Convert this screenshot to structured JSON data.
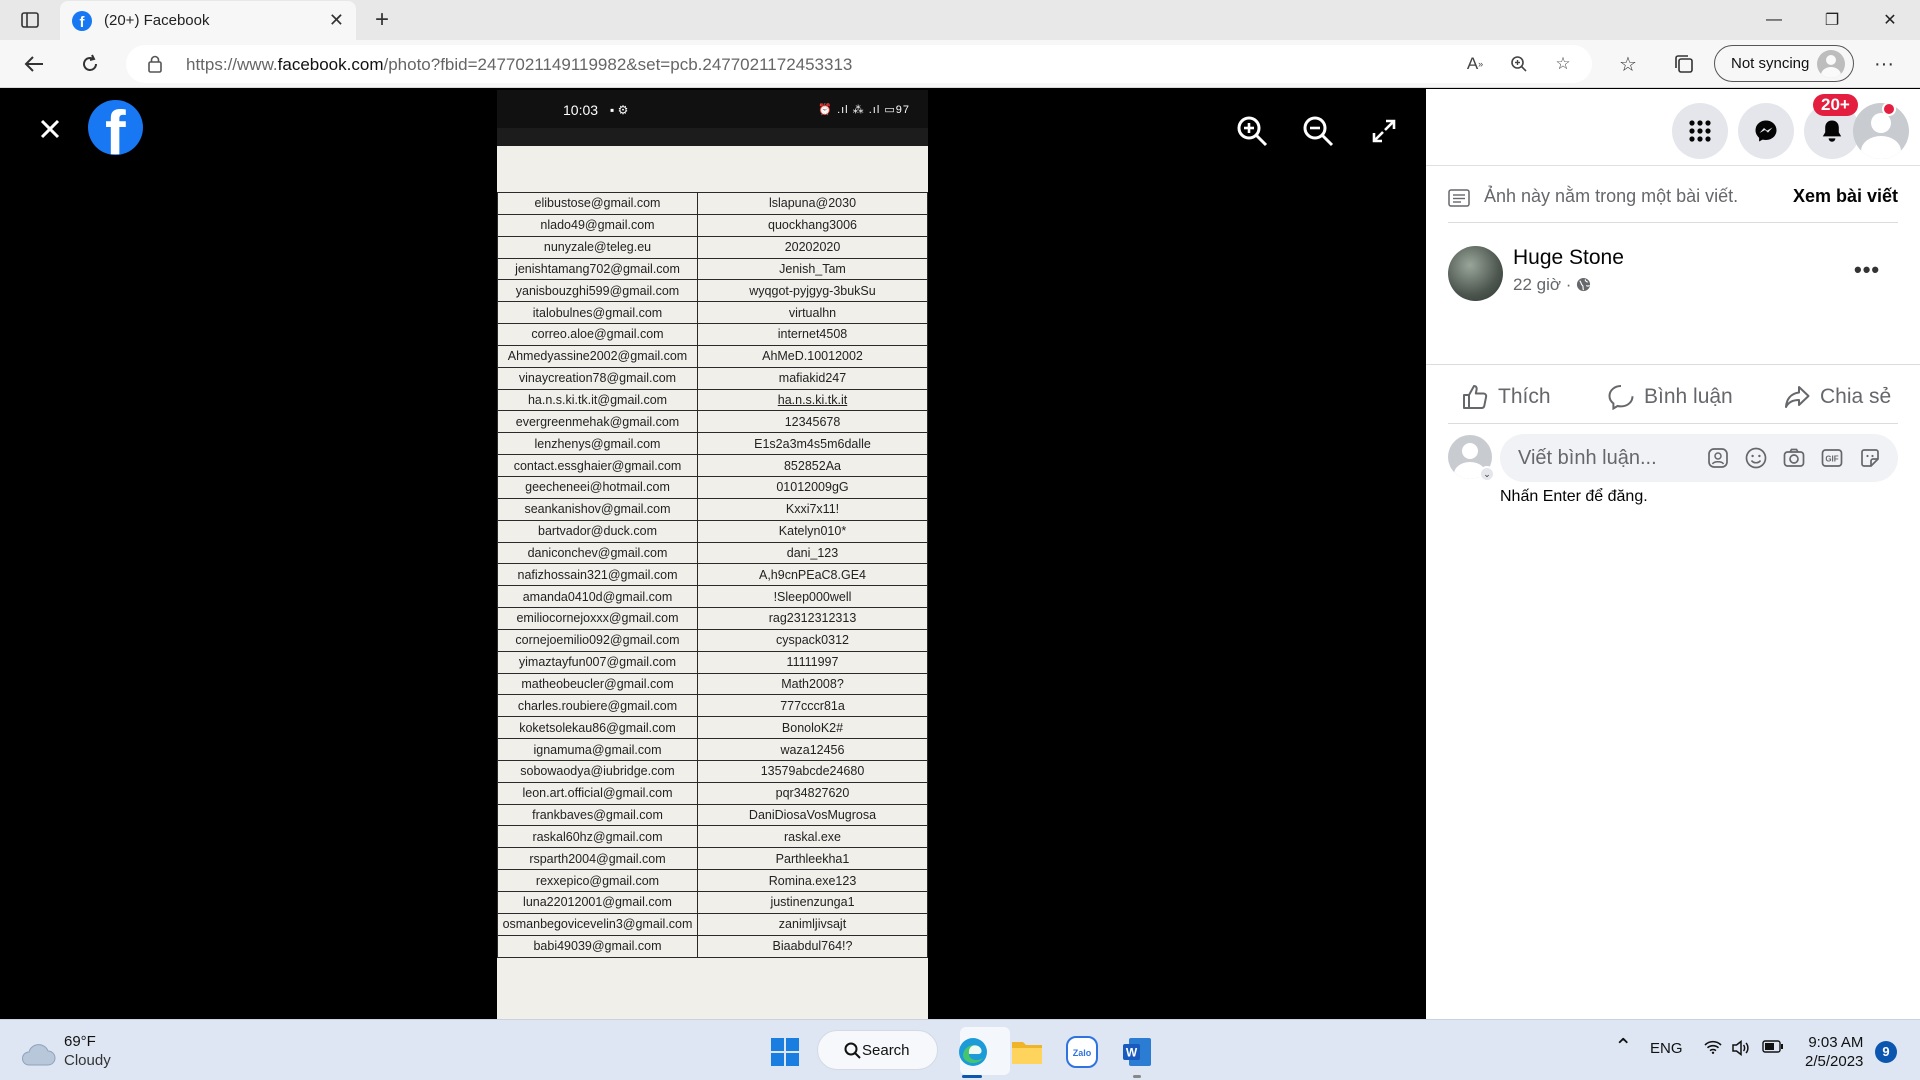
{
  "browser": {
    "tab_title": "(20+) Facebook",
    "url_prefix": "https://www.",
    "url_domain": "facebook.com",
    "url_path": "/photo?fbid=2477021149119982&set=pcb.2477021172453313",
    "sync_label": "Not syncing"
  },
  "viewer": {
    "phone_time": "10:03",
    "phone_battery": "97",
    "rows": [
      [
        "elibustose@gmail.com",
        "lslapuna@2030"
      ],
      [
        "nlado49@gmail.com",
        "quockhang3006"
      ],
      [
        "nunyzale@teleg.eu",
        "20202020"
      ],
      [
        "jenishtamang702@gmail.com",
        "Jenish_Tam"
      ],
      [
        "yanisbouzghi599@gmail.com",
        "wyqgot-pyjgyg-3bukSu"
      ],
      [
        "italobulnes@gmail.com",
        "virtualhn"
      ],
      [
        "correo.aloe@gmail.com",
        "internet4508"
      ],
      [
        "Ahmedyassine2002@gmail.com",
        "AhMeD.10012002"
      ],
      [
        "vinaycreation78@gmail.com",
        "mafiakid247"
      ],
      [
        "ha.n.s.ki.tk.it@gmail.com",
        "ha.n.s.ki.tk.it"
      ],
      [
        "evergreenmehak@gmail.com",
        "12345678"
      ],
      [
        "lenzhenys@gmail.com",
        "E1s2a3m4s5m6dalle"
      ],
      [
        "contact.essghaier@gmail.com",
        "852852Aa"
      ],
      [
        "geecheneei@hotmail.com",
        "01012009gG"
      ],
      [
        "seankanishov@gmail.com",
        "Kxxi7x11!"
      ],
      [
        "bartvador@duck.com",
        "Katelyn010*"
      ],
      [
        "daniconchev@gmail.com",
        "dani_123"
      ],
      [
        "nafizhossain321@gmail.com",
        "A,h9cnPEaC8.GE4"
      ],
      [
        "amanda0410d@gmail.com",
        "!Sleep000well"
      ],
      [
        "emiliocornejoxxx@gmail.com",
        "rag2312312313"
      ],
      [
        "cornejoemilio092@gmail.com",
        "cyspack0312"
      ],
      [
        "yimaztayfun007@gmail.com",
        "11111997"
      ],
      [
        "matheobeucler@gmail.com",
        "Math2008?"
      ],
      [
        "charles.roubiere@gmail.com",
        "777cccr81a"
      ],
      [
        "koketsolekau86@gmail.com",
        "BonoloK2#"
      ],
      [
        "ignamuma@gmail.com",
        "waza12456"
      ],
      [
        "sobowaodya@iubridge.com",
        "13579abcde24680"
      ],
      [
        "leon.art.official@gmail.com",
        "pqr34827620"
      ],
      [
        "frankbaves@gmail.com",
        "DaniDiosaVosMugrosa"
      ],
      [
        "raskal60hz@gmail.com",
        "raskal.exe"
      ],
      [
        "rsparth2004@gmail.com",
        "Parthleekha1"
      ],
      [
        "rexxepico@gmail.com",
        "Romina.exe123"
      ],
      [
        "luna22012001@gmail.com",
        "justinenzunga1"
      ],
      [
        "osmanbegovicevelin3@gmail.com",
        "zanimljivsajt"
      ],
      [
        "babi49039@gmail.com",
        "Biaabdul764!?"
      ]
    ]
  },
  "panel": {
    "notif_badge": "20+",
    "post_note": "Ảnh này nằm trong một bài viết.",
    "view_post": "Xem bài viết",
    "author": "Huge Stone",
    "post_time": "22 giờ ·",
    "like_label": "Thích",
    "comment_label": "Bình luận",
    "share_label": "Chia sẻ",
    "comment_placeholder": "Viết bình luận...",
    "enter_hint": "Nhấn Enter để đăng."
  },
  "taskbar": {
    "temp": "69°F",
    "condition": "Cloudy",
    "search_label": "Search",
    "lang": "ENG",
    "time": "9:03 AM",
    "date": "2/5/2023",
    "notifications": "9"
  },
  "colors": {
    "facebook_blue": "#1877f2",
    "badge_red": "#e41e3f"
  }
}
